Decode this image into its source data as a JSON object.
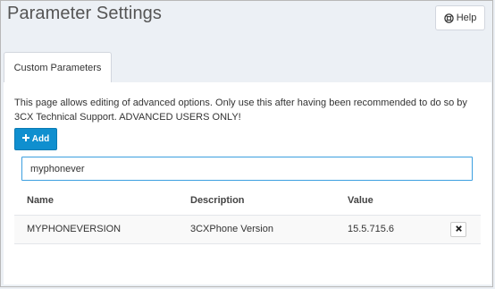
{
  "header": {
    "title": "Parameter Settings",
    "help_label": "Help",
    "help_icon": "life-ring-icon"
  },
  "tabs": [
    {
      "label": "Custom Parameters",
      "active": true
    }
  ],
  "panel": {
    "description": "This page allows editing of advanced options. Only use this after having been recommended to do so by 3CX Technical Support. ADVANCED USERS ONLY!",
    "add_label": "Add",
    "add_icon": "plus-icon",
    "search": {
      "value": "myphonever"
    }
  },
  "table": {
    "columns": [
      "Name",
      "Description",
      "Value",
      ""
    ],
    "rows": [
      {
        "name": "MYPHONEVERSION",
        "description": "3CXPhone Version",
        "value": "15.5.715.6",
        "action_icon": "close-icon"
      }
    ]
  },
  "colors": {
    "accent": "#0f8fcf",
    "background": "#ecf0f5",
    "focus_border": "#3c9fe0"
  }
}
